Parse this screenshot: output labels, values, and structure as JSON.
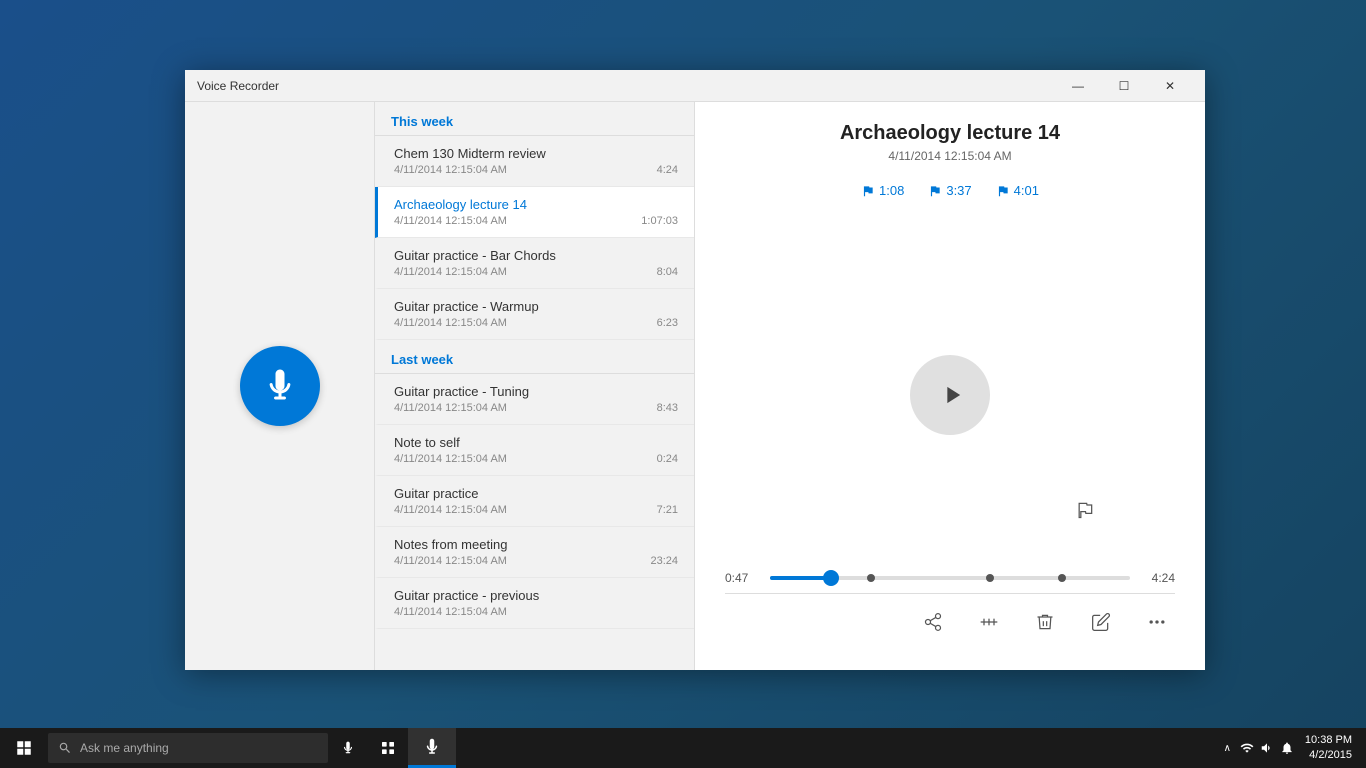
{
  "app": {
    "title": "Voice Recorder",
    "window_controls": {
      "minimize": "—",
      "maximize": "☐",
      "close": "✕"
    }
  },
  "recording_list": {
    "this_week_label": "This week",
    "last_week_label": "Last week",
    "this_week": [
      {
        "name": "Chem 130 Midterm review",
        "date": "4/11/2014 12:15:04 AM",
        "duration": "4:24",
        "active": false
      },
      {
        "name": "Archaeology lecture 14",
        "date": "4/11/2014 12:15:04 AM",
        "duration": "1:07:03",
        "active": true
      },
      {
        "name": "Guitar practice - Bar Chords",
        "date": "4/11/2014 12:15:04 AM",
        "duration": "8:04",
        "active": false
      },
      {
        "name": "Guitar practice - Warmup",
        "date": "4/11/2014 12:15:04 AM",
        "duration": "6:23",
        "active": false
      }
    ],
    "last_week": [
      {
        "name": "Guitar practice - Tuning",
        "date": "4/11/2014 12:15:04 AM",
        "duration": "8:43",
        "active": false
      },
      {
        "name": "Note to self",
        "date": "4/11/2014 12:15:04 AM",
        "duration": "0:24",
        "active": false
      },
      {
        "name": "Guitar practice",
        "date": "4/11/2014 12:15:04 AM",
        "duration": "7:21",
        "active": false
      },
      {
        "name": "Notes from meeting",
        "date": "4/11/2014 12:15:04 AM",
        "duration": "23:24",
        "active": false
      },
      {
        "name": "Guitar practice - previous",
        "date": "4/11/2014 12:15:04 AM",
        "duration": "",
        "active": false
      }
    ]
  },
  "player": {
    "title": "Archaeology lecture 14",
    "date": "4/11/2014 12:15:04 AM",
    "markers": [
      {
        "time": "1:08"
      },
      {
        "time": "3:37"
      },
      {
        "time": "4:01"
      }
    ],
    "current_time": "0:47",
    "total_time": "4:24",
    "progress_percent": 17
  },
  "taskbar": {
    "search_placeholder": "Ask me anything",
    "time": "10:38 PM",
    "date": "4/2/2015"
  }
}
